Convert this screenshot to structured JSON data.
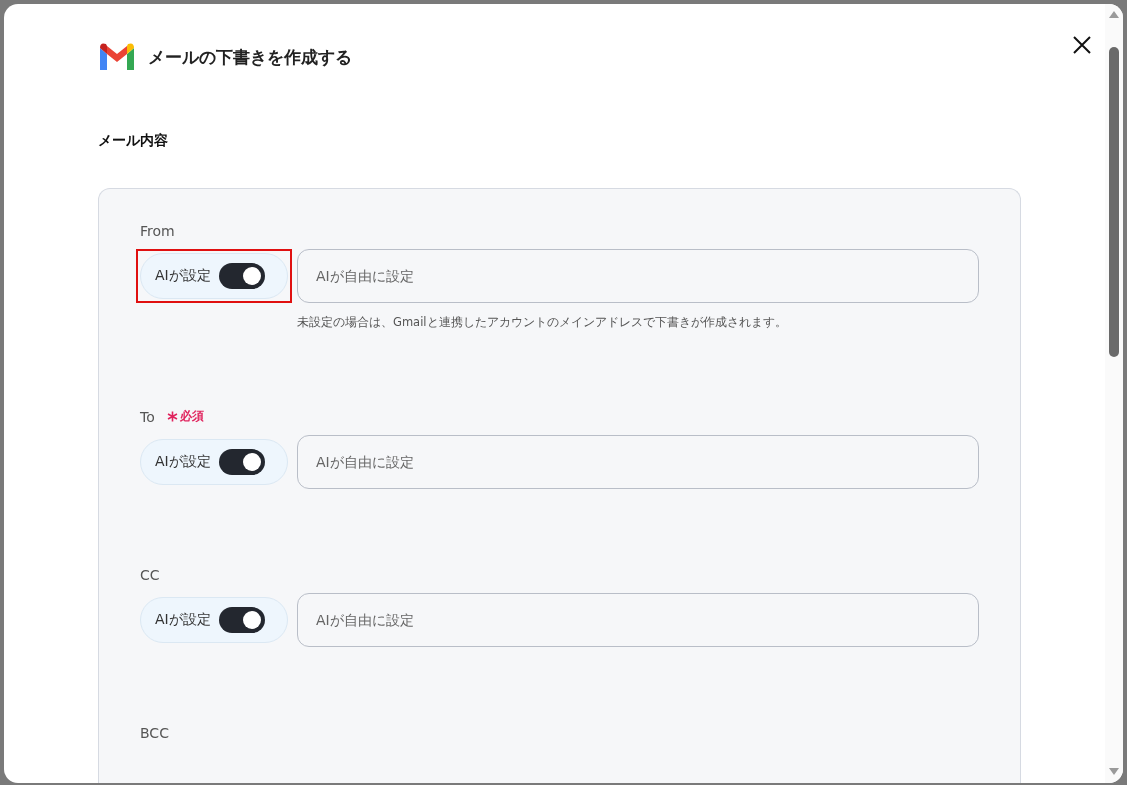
{
  "dialog": {
    "title": "メールの下書きを作成する"
  },
  "section": {
    "title": "メール内容"
  },
  "fields": [
    {
      "label": "From",
      "required": false,
      "toggle": {
        "label": "AIが設定",
        "on": true,
        "highlighted": true
      },
      "placeholder": "AIが自由に設定",
      "hint": "未設定の場合は、Gmailと連携したアカウントのメインアドレスで下書きが作成されます。"
    },
    {
      "label": "To",
      "required": true,
      "required_label": "必須",
      "toggle": {
        "label": "AIが設定",
        "on": true,
        "highlighted": false
      },
      "placeholder": "AIが自由に設定"
    },
    {
      "label": "CC",
      "required": false,
      "toggle": {
        "label": "AIが設定",
        "on": true,
        "highlighted": false
      },
      "placeholder": "AIが自由に設定"
    },
    {
      "label": "BCC",
      "required": false
    }
  ]
}
